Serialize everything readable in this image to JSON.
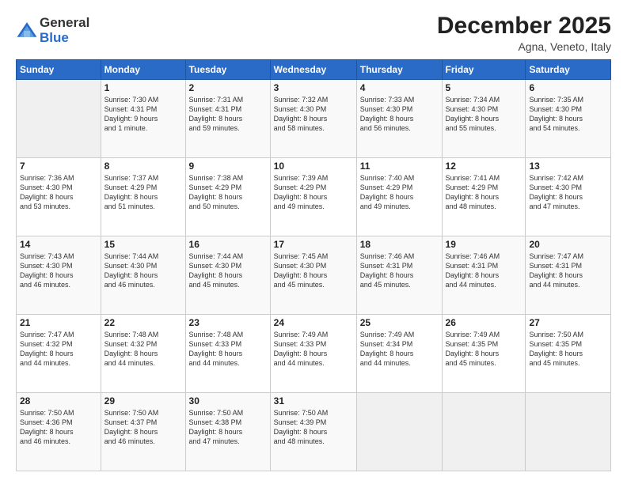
{
  "logo": {
    "general": "General",
    "blue": "Blue"
  },
  "title": "December 2025",
  "location": "Agna, Veneto, Italy",
  "days_header": [
    "Sunday",
    "Monday",
    "Tuesday",
    "Wednesday",
    "Thursday",
    "Friday",
    "Saturday"
  ],
  "weeks": [
    [
      {
        "day": "",
        "detail": ""
      },
      {
        "day": "1",
        "detail": "Sunrise: 7:30 AM\nSunset: 4:31 PM\nDaylight: 9 hours\nand 1 minute."
      },
      {
        "day": "2",
        "detail": "Sunrise: 7:31 AM\nSunset: 4:31 PM\nDaylight: 8 hours\nand 59 minutes."
      },
      {
        "day": "3",
        "detail": "Sunrise: 7:32 AM\nSunset: 4:30 PM\nDaylight: 8 hours\nand 58 minutes."
      },
      {
        "day": "4",
        "detail": "Sunrise: 7:33 AM\nSunset: 4:30 PM\nDaylight: 8 hours\nand 56 minutes."
      },
      {
        "day": "5",
        "detail": "Sunrise: 7:34 AM\nSunset: 4:30 PM\nDaylight: 8 hours\nand 55 minutes."
      },
      {
        "day": "6",
        "detail": "Sunrise: 7:35 AM\nSunset: 4:30 PM\nDaylight: 8 hours\nand 54 minutes."
      }
    ],
    [
      {
        "day": "7",
        "detail": "Sunrise: 7:36 AM\nSunset: 4:30 PM\nDaylight: 8 hours\nand 53 minutes."
      },
      {
        "day": "8",
        "detail": "Sunrise: 7:37 AM\nSunset: 4:29 PM\nDaylight: 8 hours\nand 51 minutes."
      },
      {
        "day": "9",
        "detail": "Sunrise: 7:38 AM\nSunset: 4:29 PM\nDaylight: 8 hours\nand 50 minutes."
      },
      {
        "day": "10",
        "detail": "Sunrise: 7:39 AM\nSunset: 4:29 PM\nDaylight: 8 hours\nand 49 minutes."
      },
      {
        "day": "11",
        "detail": "Sunrise: 7:40 AM\nSunset: 4:29 PM\nDaylight: 8 hours\nand 49 minutes."
      },
      {
        "day": "12",
        "detail": "Sunrise: 7:41 AM\nSunset: 4:29 PM\nDaylight: 8 hours\nand 48 minutes."
      },
      {
        "day": "13",
        "detail": "Sunrise: 7:42 AM\nSunset: 4:30 PM\nDaylight: 8 hours\nand 47 minutes."
      }
    ],
    [
      {
        "day": "14",
        "detail": "Sunrise: 7:43 AM\nSunset: 4:30 PM\nDaylight: 8 hours\nand 46 minutes."
      },
      {
        "day": "15",
        "detail": "Sunrise: 7:44 AM\nSunset: 4:30 PM\nDaylight: 8 hours\nand 46 minutes."
      },
      {
        "day": "16",
        "detail": "Sunrise: 7:44 AM\nSunset: 4:30 PM\nDaylight: 8 hours\nand 45 minutes."
      },
      {
        "day": "17",
        "detail": "Sunrise: 7:45 AM\nSunset: 4:30 PM\nDaylight: 8 hours\nand 45 minutes."
      },
      {
        "day": "18",
        "detail": "Sunrise: 7:46 AM\nSunset: 4:31 PM\nDaylight: 8 hours\nand 45 minutes."
      },
      {
        "day": "19",
        "detail": "Sunrise: 7:46 AM\nSunset: 4:31 PM\nDaylight: 8 hours\nand 44 minutes."
      },
      {
        "day": "20",
        "detail": "Sunrise: 7:47 AM\nSunset: 4:31 PM\nDaylight: 8 hours\nand 44 minutes."
      }
    ],
    [
      {
        "day": "21",
        "detail": "Sunrise: 7:47 AM\nSunset: 4:32 PM\nDaylight: 8 hours\nand 44 minutes."
      },
      {
        "day": "22",
        "detail": "Sunrise: 7:48 AM\nSunset: 4:32 PM\nDaylight: 8 hours\nand 44 minutes."
      },
      {
        "day": "23",
        "detail": "Sunrise: 7:48 AM\nSunset: 4:33 PM\nDaylight: 8 hours\nand 44 minutes."
      },
      {
        "day": "24",
        "detail": "Sunrise: 7:49 AM\nSunset: 4:33 PM\nDaylight: 8 hours\nand 44 minutes."
      },
      {
        "day": "25",
        "detail": "Sunrise: 7:49 AM\nSunset: 4:34 PM\nDaylight: 8 hours\nand 44 minutes."
      },
      {
        "day": "26",
        "detail": "Sunrise: 7:49 AM\nSunset: 4:35 PM\nDaylight: 8 hours\nand 45 minutes."
      },
      {
        "day": "27",
        "detail": "Sunrise: 7:50 AM\nSunset: 4:35 PM\nDaylight: 8 hours\nand 45 minutes."
      }
    ],
    [
      {
        "day": "28",
        "detail": "Sunrise: 7:50 AM\nSunset: 4:36 PM\nDaylight: 8 hours\nand 46 minutes."
      },
      {
        "day": "29",
        "detail": "Sunrise: 7:50 AM\nSunset: 4:37 PM\nDaylight: 8 hours\nand 46 minutes."
      },
      {
        "day": "30",
        "detail": "Sunrise: 7:50 AM\nSunset: 4:38 PM\nDaylight: 8 hours\nand 47 minutes."
      },
      {
        "day": "31",
        "detail": "Sunrise: 7:50 AM\nSunset: 4:39 PM\nDaylight: 8 hours\nand 48 minutes."
      },
      {
        "day": "",
        "detail": ""
      },
      {
        "day": "",
        "detail": ""
      },
      {
        "day": "",
        "detail": ""
      }
    ]
  ]
}
